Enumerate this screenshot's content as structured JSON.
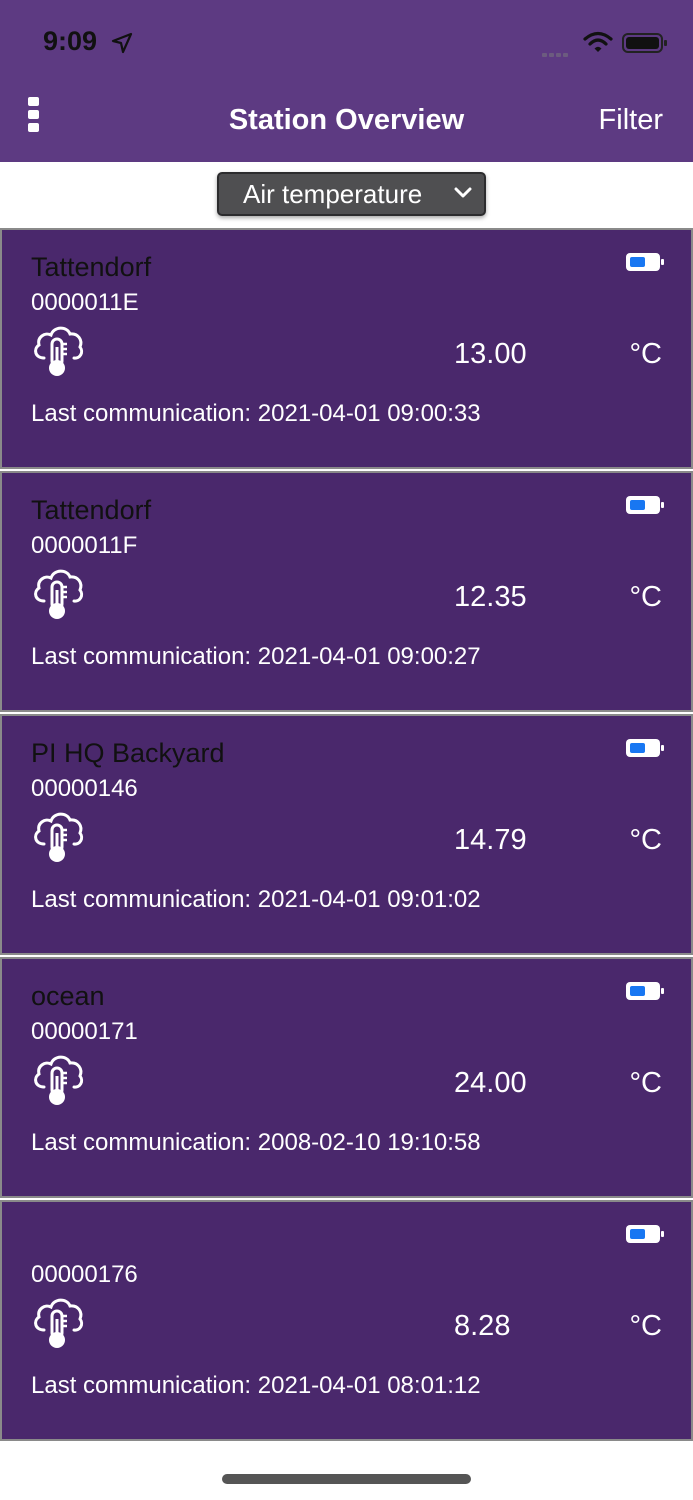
{
  "status_bar": {
    "time": "9:09"
  },
  "header": {
    "title": "Station Overview",
    "filter_label": "Filter"
  },
  "selector": {
    "value": "Air temperature"
  },
  "stations": [
    {
      "name": "Tattendorf",
      "serial": "0000011E",
      "value": "13.00",
      "unit": "°C",
      "last_communication": "Last communication: 2021-04-01 09:00:33"
    },
    {
      "name": "Tattendorf",
      "serial": "0000011F",
      "value": "12.35",
      "unit": "°C",
      "last_communication": "Last communication: 2021-04-01 09:00:27"
    },
    {
      "name": "PI HQ Backyard",
      "serial": "00000146",
      "value": "14.79",
      "unit": "°C",
      "last_communication": "Last communication: 2021-04-01 09:01:02"
    },
    {
      "name": "ocean",
      "serial": "00000171",
      "value": "24.00",
      "unit": "°C",
      "last_communication": "Last communication: 2008-02-10 19:10:58"
    },
    {
      "name": "",
      "serial": "00000176",
      "value": "8.28",
      "unit": "°C",
      "last_communication": "Last communication: 2021-04-01 08:01:12"
    }
  ],
  "colors": {
    "header": "#5d3a82",
    "card": "#4a286c",
    "battery_fill": "#1877f2"
  },
  "icons": {
    "menu": "kebab-menu-icon",
    "station": "cloud-thermometer-icon",
    "battery": "battery-icon"
  }
}
